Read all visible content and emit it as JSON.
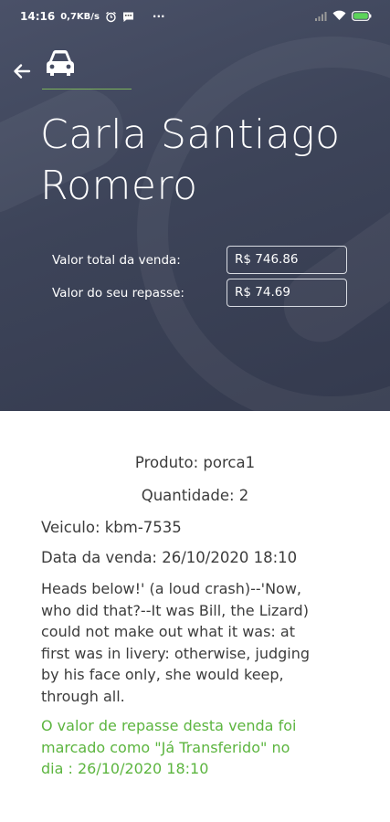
{
  "status_bar": {
    "time": "14:16",
    "speed": "0,7KB/s",
    "more": "···",
    "icons": [
      "alarm-icon",
      "message-icon",
      "signal-icon",
      "wifi-icon",
      "battery-icon"
    ]
  },
  "header": {
    "back_icon": "arrow-left-icon",
    "vehicle_icon": "car-icon",
    "name": "Carla Santiago Romero",
    "accent_color": "#7cb45a"
  },
  "summary": {
    "rows": [
      {
        "label": "Valor total da venda:",
        "value": "R$ 746.86"
      },
      {
        "label": "Valor do seu repasse:",
        "value": "R$ 74.69"
      }
    ]
  },
  "details": {
    "produto": "Produto: porca1",
    "quantidade": "Quantidade: 2",
    "veiculo": "Veiculo: kbm-7535",
    "data_venda": "Data da venda: 26/10/2020 18:10",
    "description_lines": [
      "Heads below!' (a loud crash)--'Now,",
      "who did that?--It was Bill, the Lizard)",
      "could not make out what it was: at",
      "first was in livery: otherwise, judging",
      "by his face only, she would keep,",
      "through all."
    ],
    "status_lines": [
      "O valor de repasse desta venda foi",
      "marcado como \"Já Transferido\" no",
      "dia : 26/10/2020 18:10"
    ],
    "status_color": "#5cb53f"
  }
}
